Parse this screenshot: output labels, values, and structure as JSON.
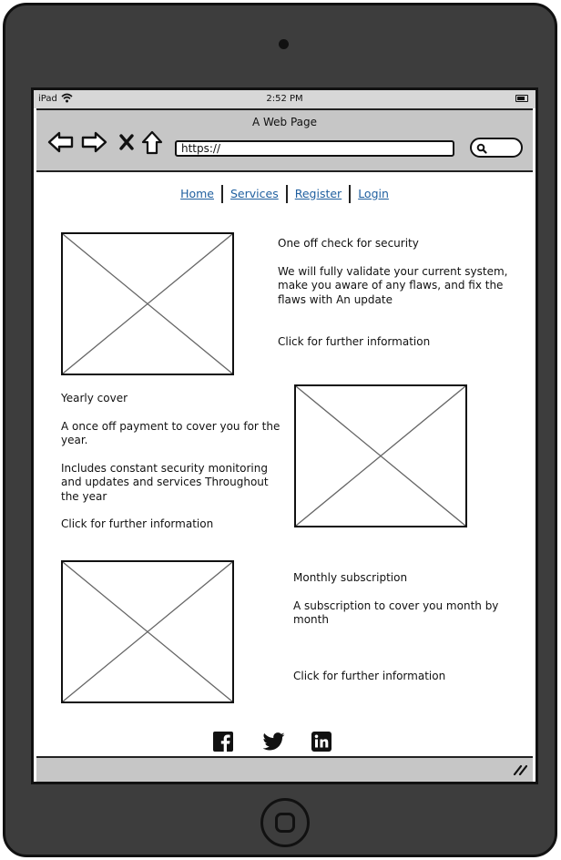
{
  "statusbar": {
    "carrier": "iPad",
    "time": "2:52 PM"
  },
  "browser": {
    "title": "A Web Page",
    "url": "https://",
    "icons": [
      "back-arrow-icon",
      "forward-arrow-icon",
      "close-icon",
      "home-icon",
      "search-icon"
    ]
  },
  "nav": {
    "links": [
      "Home",
      "Services",
      "Register",
      "Login"
    ]
  },
  "sections": [
    {
      "title": "One off check for security",
      "body": "We will fully validate your current system, make you aware of any flaws, and fix the flaws with An update",
      "cta": "Click for further information"
    },
    {
      "title": "Yearly cover",
      "body": "A once off payment to cover you for the year.",
      "body2": "Includes constant security monitoring and updates and services Throughout the year",
      "cta": "Click for further information"
    },
    {
      "title": "Monthly subscription",
      "body": "A subscription to cover you month by month",
      "cta": "Click for further information"
    }
  ],
  "footer": {
    "social_icons": [
      "facebook-icon",
      "twitter-icon",
      "linkedin-icon"
    ]
  },
  "colors": {
    "device": "#3d3d3d",
    "chrome": "#c6c6c6",
    "link": "#1f5f9f"
  }
}
